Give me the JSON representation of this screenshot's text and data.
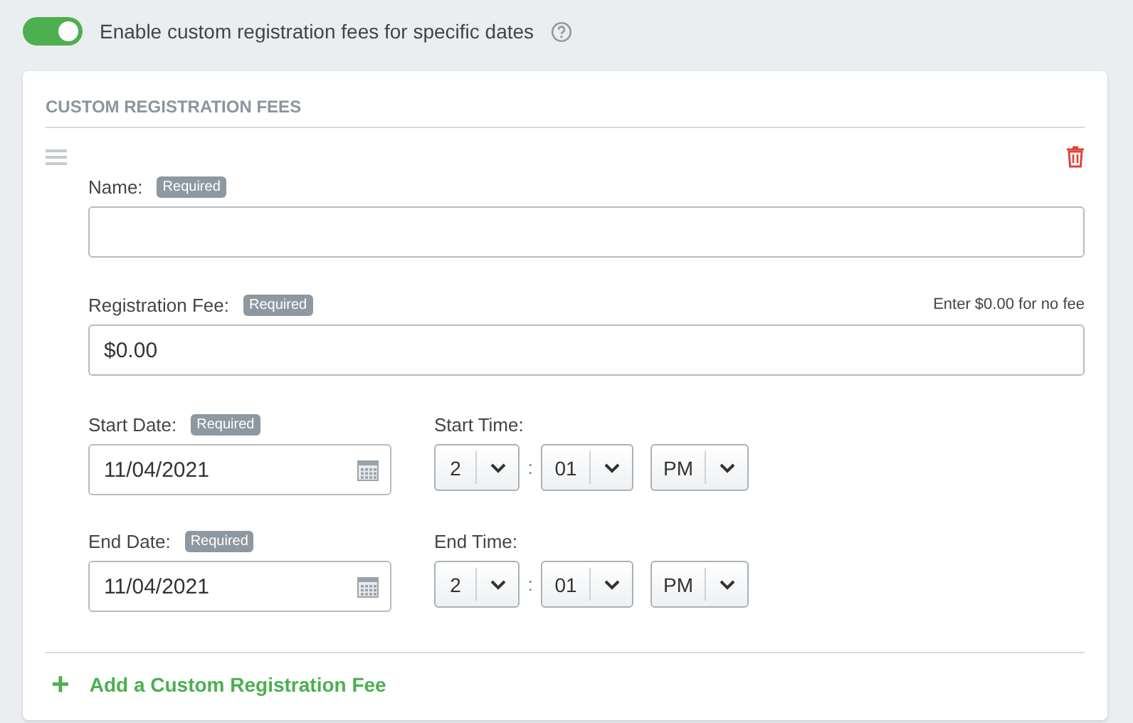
{
  "toggle": {
    "on": true,
    "label": "Enable custom registration fees for specific dates"
  },
  "card": {
    "title": "CUSTOM REGISTRATION FEES",
    "name_field": {
      "label": "Name:",
      "badge": "Required"
    },
    "fee_field": {
      "label": "Registration Fee:",
      "badge": "Required",
      "hint": "Enter $0.00 for no fee",
      "value": "$0.00"
    },
    "date_rows": [
      {
        "date_label": "Start Date:",
        "badge": "Required",
        "date": "11/04/2021",
        "time_label": "Start Time:",
        "hour": "2",
        "separator": ":",
        "minute": "01",
        "ampm": "PM"
      },
      {
        "date_label": "End Date:",
        "badge": "Required",
        "date": "11/04/2021",
        "time_label": "End Time:",
        "hour": "2",
        "separator": ":",
        "minute": "01",
        "ampm": "PM"
      }
    ],
    "add_link": {
      "icon": "+",
      "label": "Add a Custom Registration Fee"
    }
  }
}
